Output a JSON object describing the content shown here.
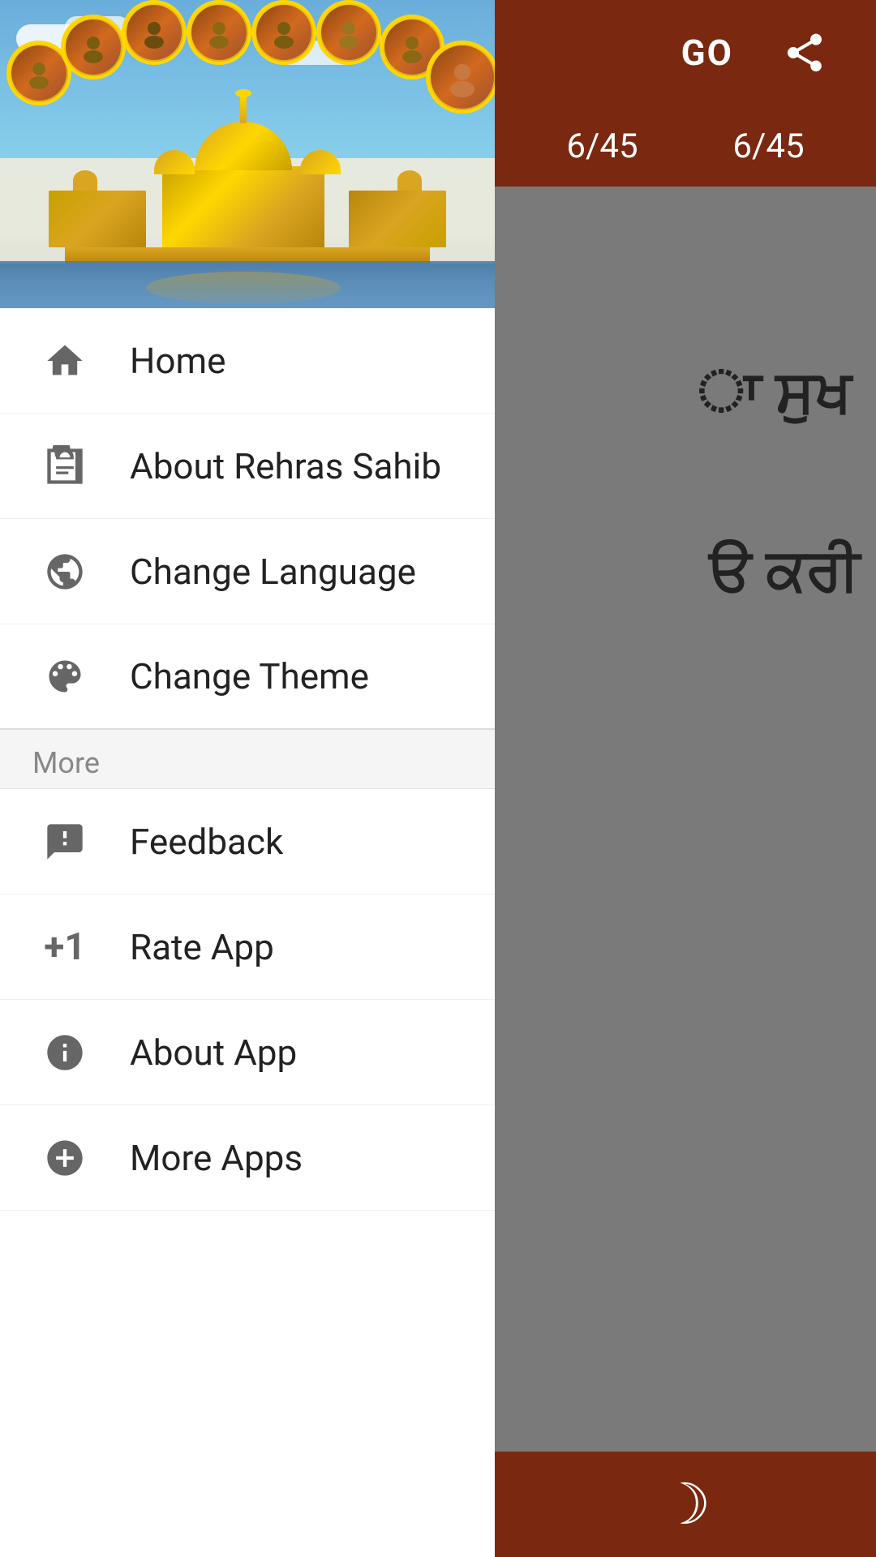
{
  "topbar": {
    "go_label": "GO",
    "share_icon": "share",
    "page_current_left": "6/45",
    "page_current_right": "6/45"
  },
  "background": {
    "punjabi_text_1": "ਾ ਸੁਖ",
    "punjabi_text_2": "ੳ ਕਰੀ",
    "moon_symbol": "☽"
  },
  "drawer": {
    "menu_items": [
      {
        "id": "home",
        "label": "Home",
        "icon": "home"
      },
      {
        "id": "about-rehras",
        "label": "About Rehras Sahib",
        "icon": "book"
      },
      {
        "id": "change-language",
        "label": "Change Language",
        "icon": "globe"
      },
      {
        "id": "change-theme",
        "label": "Change Theme",
        "icon": "palette"
      }
    ],
    "more_label": "More",
    "more_items": [
      {
        "id": "feedback",
        "label": "Feedback",
        "icon": "feedback"
      },
      {
        "id": "rate-app",
        "label": "Rate App",
        "icon": "rate"
      },
      {
        "id": "about-app",
        "label": "About App",
        "icon": "info"
      },
      {
        "id": "more-apps",
        "label": "More Apps",
        "icon": "add-circle"
      }
    ]
  }
}
